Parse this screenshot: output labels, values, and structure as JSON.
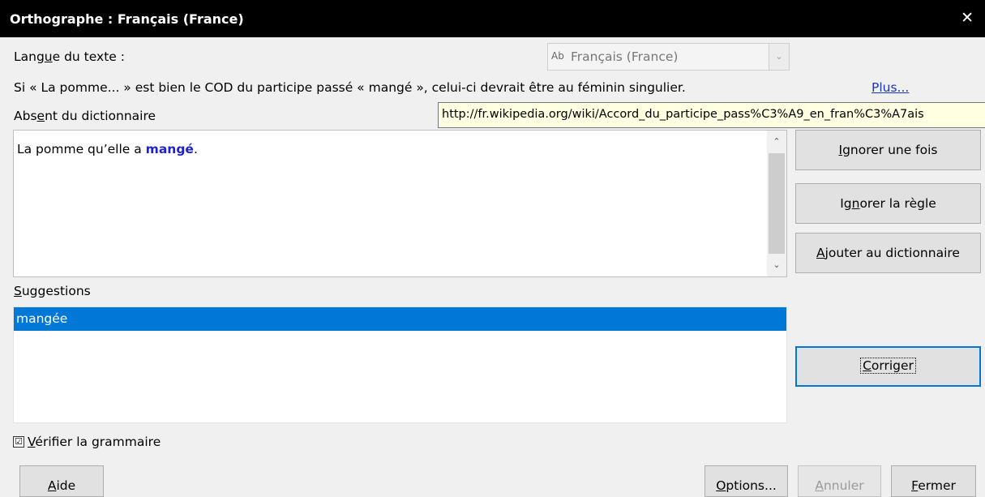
{
  "window": {
    "title": "Orthographe : Français (France)",
    "close_glyph": "✕"
  },
  "language": {
    "label_pre": "Lang",
    "label_key": "u",
    "label_post": "e du texte :",
    "icon_text": "Ab",
    "value": "Français (France)",
    "arrow": "⌄"
  },
  "message": {
    "text": "Si « La  pomme... » est bien le COD du participe passé « mangé », celui-ci devrait être au féminin singulier.",
    "more_link": "Plus..."
  },
  "absent": {
    "label_pre": "Abs",
    "label_key": "e",
    "label_post": "nt du dictionnaire"
  },
  "tooltip": {
    "text": "http://fr.wikipedia.org/wiki/Accord_du_participe_pass%C3%A9_en_fran%C3%A7ais"
  },
  "sentence": {
    "before": "La pomme qu’elle a ",
    "error_word": "mangé",
    "after": "."
  },
  "scroll": {
    "up": "⌃",
    "down": "⌄"
  },
  "suggestions": {
    "label_key": "S",
    "label_post": "uggestions",
    "items": [
      "mangée"
    ]
  },
  "grammar": {
    "check_mark": "☑",
    "label_key": "V",
    "label_post": "érifier la grammaire",
    "checked": true
  },
  "buttons": {
    "ignore_once": {
      "key": "I",
      "rest": "gnorer une fois"
    },
    "ignore_rule": {
      "pre": "Ig",
      "key": "n",
      "rest": "orer la règle"
    },
    "add_dict": {
      "key": "A",
      "rest": "jouter au dictionnaire"
    },
    "correct": {
      "key": "C",
      "rest": "orriger"
    },
    "help": {
      "key": "A",
      "rest": "ide"
    },
    "options": {
      "key": "O",
      "rest": "ptions..."
    },
    "undo": {
      "key": "A",
      "rest": "nnuler"
    },
    "close": {
      "key": "F",
      "rest": "ermer"
    }
  }
}
